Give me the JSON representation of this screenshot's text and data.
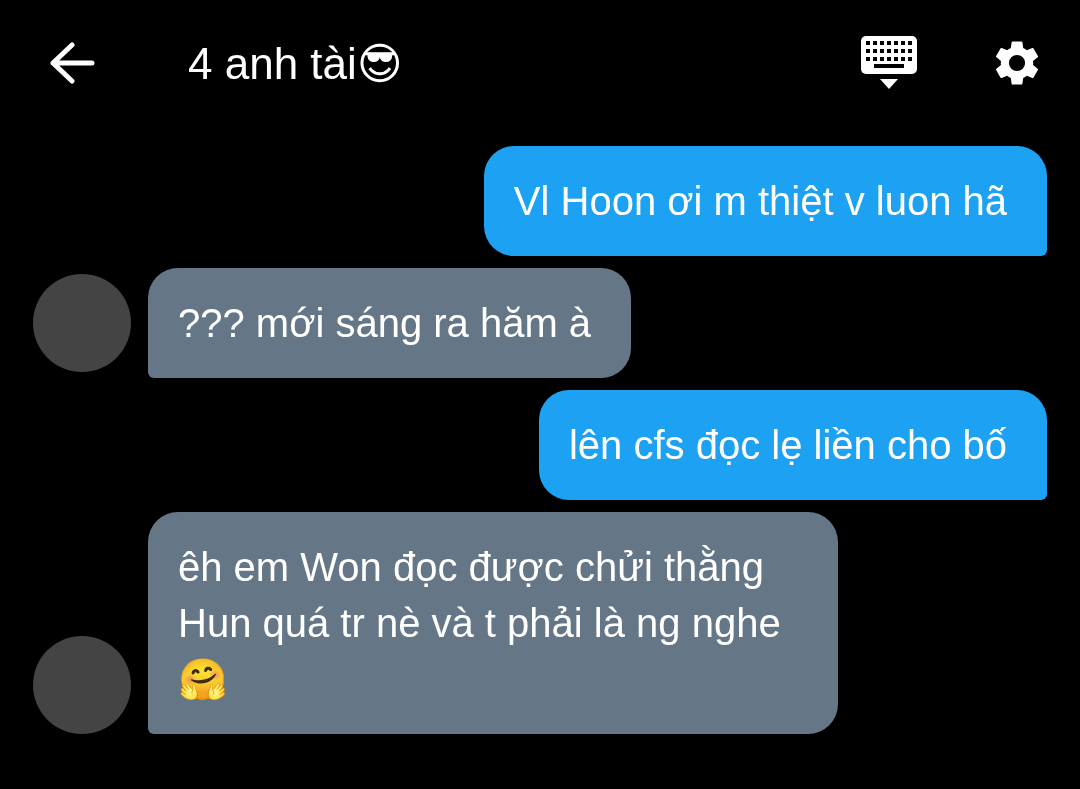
{
  "header": {
    "title": "4 anh tài😎"
  },
  "messages": [
    {
      "kind": "outgoing",
      "text": "Vl Hoon ơi m thiệt v luon hã"
    },
    {
      "kind": "incoming",
      "text": "??? mới sáng ra hăm à"
    },
    {
      "kind": "outgoing",
      "text": "lên cfs đọc lẹ liền cho bố"
    },
    {
      "kind": "incoming",
      "text": "êh em Won đọc được chửi thằng Hun quá tr nè và t phải là ng nghe 🤗"
    }
  ]
}
